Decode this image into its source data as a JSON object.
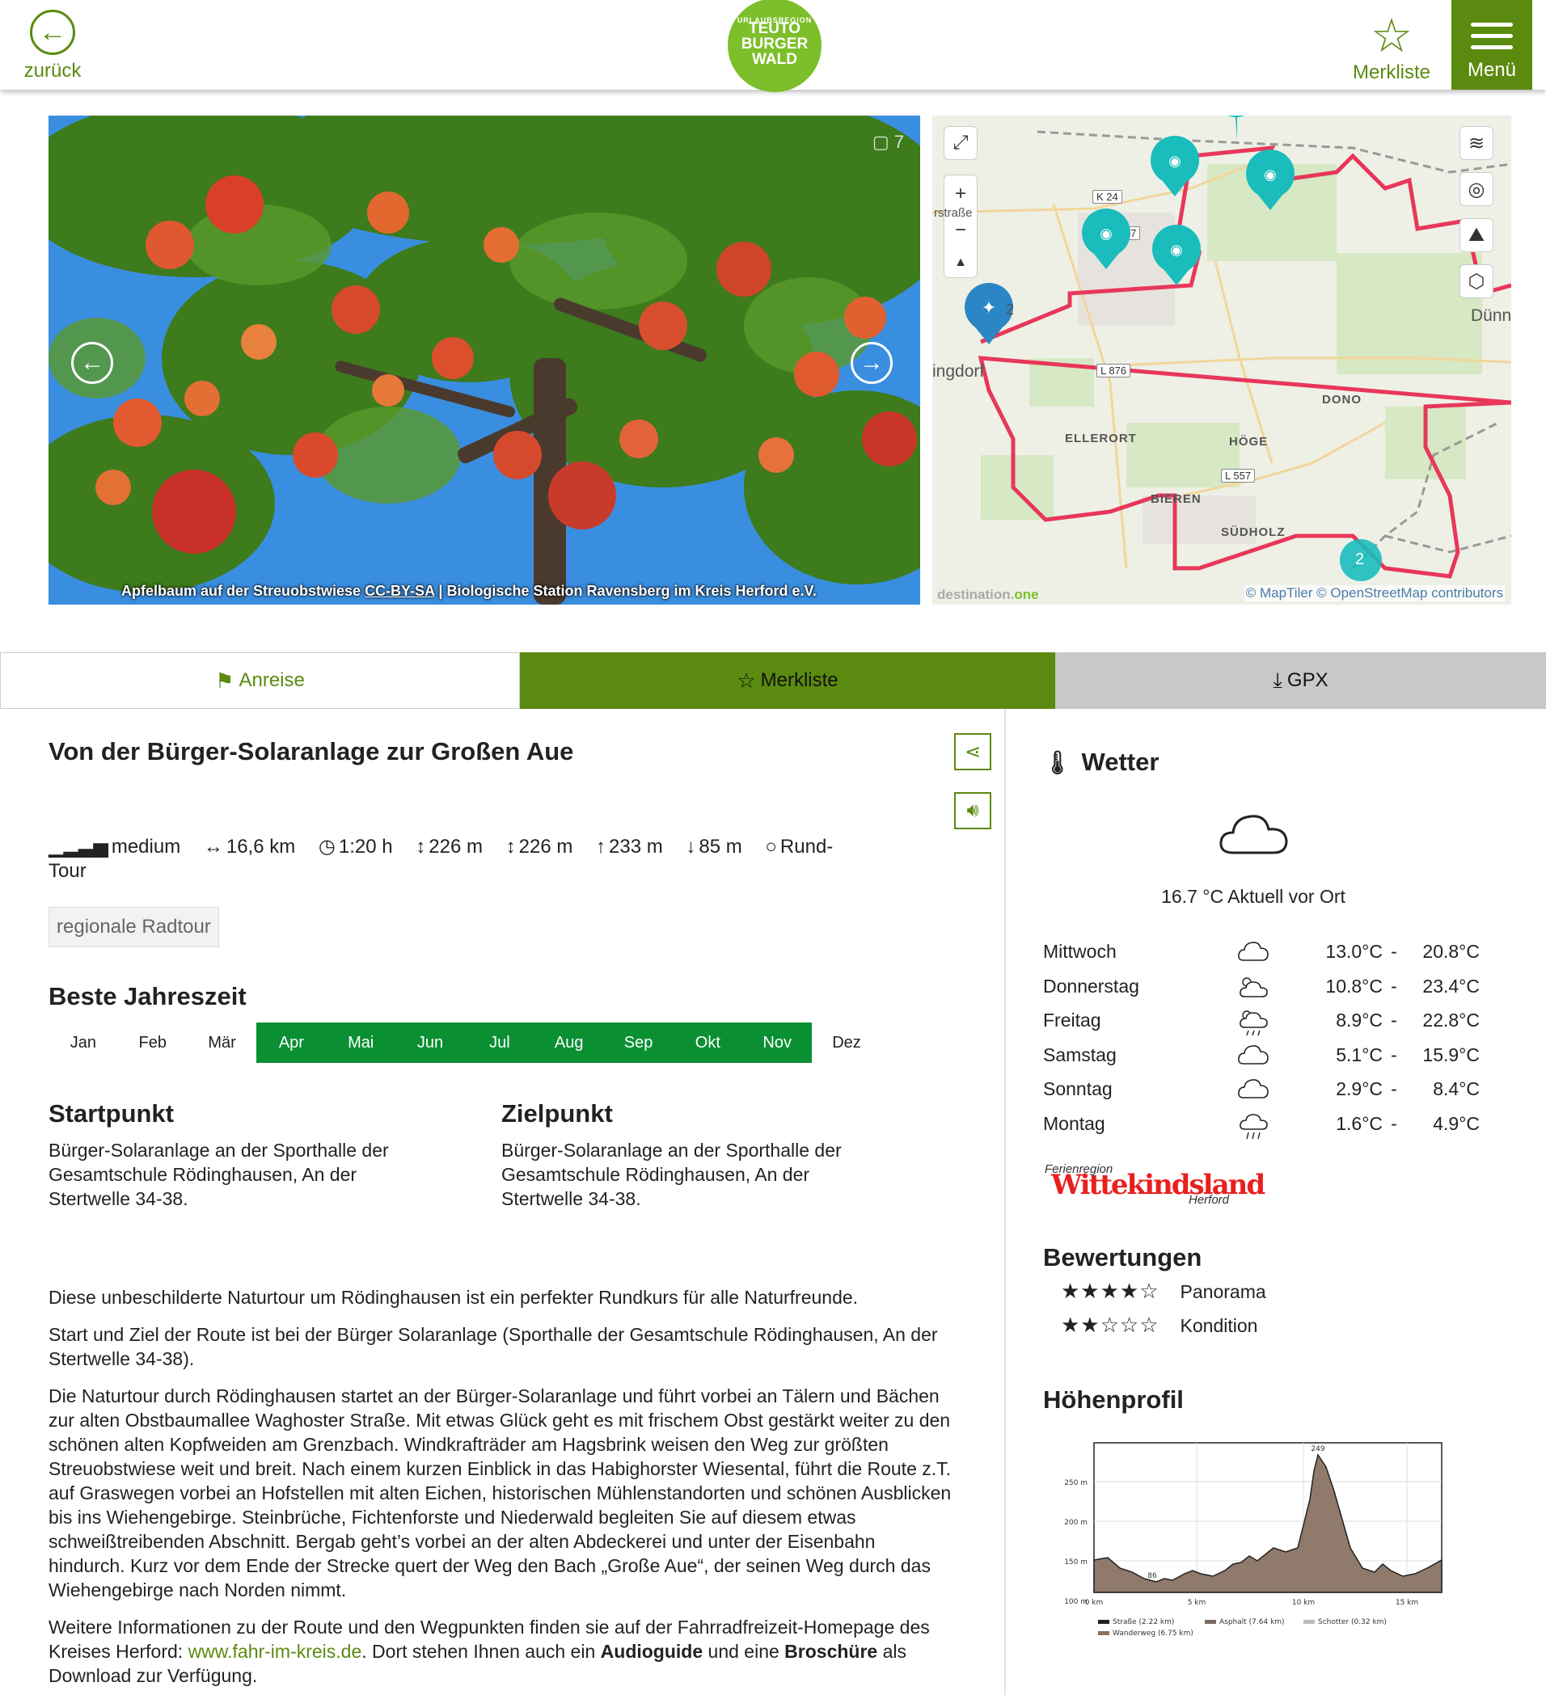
{
  "header": {
    "back_label": "zurück",
    "logo_top": "URLAUBSREGION",
    "logo_line1": "TEUTO",
    "logo_line2": "BURGER",
    "logo_line3": "WALD",
    "merkliste_label": "Merkliste",
    "menu_label": "Menü"
  },
  "gallery": {
    "count": "7",
    "caption_prefix": "Apfelbaum auf der Streuobstwiese ",
    "caption_license": "CC-BY-SA",
    "caption_suffix": " | Biologische Station Ravensberg im Kreis Herford e.V."
  },
  "map": {
    "labels": {
      "k24": "K 24",
      "l876": "L 876",
      "l557": "L 557",
      "strasse": "rstraße",
      "ingdorf": "ingdorf",
      "duenn": "Dünn",
      "dono": "DONO",
      "ellerort": "ELLERORT",
      "hoege": "HÖGE",
      "bieren": "BIEREN",
      "suedholz": "SÜDHOLZ",
      "k7": "7",
      "marker_num": "2",
      "cluster": "2"
    },
    "attribution": "© MapTiler © OpenStreetMap contributors",
    "brand_a": "destination.",
    "brand_b": "one",
    "route_color": "#e8375a",
    "marker_color": "#1abcbc"
  },
  "actions": {
    "anreise": "Anreise",
    "merkliste": "Merkliste",
    "gpx": "GPX"
  },
  "tour": {
    "title": "Von der Bürger-Solaranlage zur Großen Aue",
    "difficulty": "medium",
    "distance": "16,6 km",
    "duration": "1:20 h",
    "ascent": "226 m",
    "descent": "226 m",
    "max_alt": "233 m",
    "min_alt": "85 m",
    "type": "Rund-Tour",
    "tag": "regionale Radtour"
  },
  "season": {
    "heading": "Beste Jahreszeit",
    "months": [
      "Jan",
      "Feb",
      "Mär",
      "Apr",
      "Mai",
      "Jun",
      "Jul",
      "Aug",
      "Sep",
      "Okt",
      "Nov",
      "Dez"
    ],
    "active": [
      false,
      false,
      false,
      true,
      true,
      true,
      true,
      true,
      true,
      true,
      true,
      false
    ]
  },
  "start": {
    "heading": "Startpunkt",
    "text": "Bürger-Solaranlage an der Sporthalle der Gesamtschule Rödinghausen, An der Stertwelle 34-38."
  },
  "ziel": {
    "heading": "Zielpunkt",
    "text": "Bürger-Solaranlage an der Sporthalle der Gesamtschule Rödinghausen, An der Stertwelle 34-38."
  },
  "description": {
    "p1": "Diese unbeschilderte Naturtour um Rödinghausen ist ein perfekter Rundkurs für alle Naturfreunde.",
    "p2": "Start und Ziel der Route ist bei der Bürger Solaranlage (Sporthalle der Gesamtschule Rödinghausen, An der Stertwelle 34-38).",
    "p3": "Die Naturtour durch Rödinghausen startet an der Bürger-Solaranlage und führt vorbei an Tälern und Bächen zur alten Obstbaumallee Waghoster Straße. Mit etwas Glück geht es mit frischem Obst gestärkt weiter zu den schönen alten Kopfweiden am Grenzbach. Windkrafträder am Hagsbrink weisen den Weg zur größten Streuobstwiese weit und breit. Nach einem kurzen Einblick in das Habighorster Wiesental, führt die Route z.T. auf Graswegen vorbei an Hofstellen mit alten Eichen, historischen Mühlenstandorten und schönen Ausblicken bis ins Wiehengebirge. Steinbrüche, Fichtenforste und Niederwald begleiten Sie auf diesem etwas schweißtreibenden Abschnitt. Bergab geht’s vorbei an der alten Abdeckerei und unter der Eisenbahn hindurch. Kurz vor dem Ende der Strecke quert der Weg den Bach „Große Aue“, der seinen Weg durch das Wiehengebirge nach Norden nimmt.",
    "p4_a": "Weitere Informationen zu der Route und den Wegpunkten finden sie auf der Fahrradfreizeit-Homepage des Kreises Herford: ",
    "p4_link": "www.fahr-im-kreis.de",
    "p4_b": ". Dort stehen Ihnen auch ein ",
    "p4_audio": "Audioguide",
    "p4_c": " und eine ",
    "p4_brosch": "Broschüre",
    "p4_d": " als Download zur Verfügung."
  },
  "weather": {
    "heading": "Wetter",
    "current": "16.7 °C Aktuell vor Ort",
    "days": [
      {
        "day": "Mittwoch",
        "icon": "cloud-icon",
        "lo": "13.0°C",
        "hi": "20.8°C"
      },
      {
        "day": "Donnerstag",
        "icon": "sun-cloud-icon",
        "lo": "10.8°C",
        "hi": "23.4°C"
      },
      {
        "day": "Freitag",
        "icon": "sun-rain-icon",
        "lo": "8.9°C",
        "hi": "22.8°C"
      },
      {
        "day": "Samstag",
        "icon": "cloud-icon",
        "lo": "5.1°C",
        "hi": "15.9°C"
      },
      {
        "day": "Sonntag",
        "icon": "cloud-icon",
        "lo": "2.9°C",
        "hi": "8.4°C"
      },
      {
        "day": "Montag",
        "icon": "rain-cloud-icon",
        "lo": "1.6°C",
        "hi": "4.9°C"
      }
    ],
    "dash": "-"
  },
  "region_logo": {
    "top": "Ferienregion",
    "main": "Wittekindsland",
    "bottom": "Herford"
  },
  "ratings": {
    "heading": "Bewertungen",
    "items": [
      {
        "label": "Panorama",
        "stars": 4,
        "max": 5
      },
      {
        "label": "Kondition",
        "stars": 2,
        "max": 5
      }
    ]
  },
  "profile": {
    "heading": "Höhenprofil",
    "y_ticks": [
      "250 m",
      "200 m",
      "150 m",
      "100 m"
    ],
    "x_ticks": [
      "0 km",
      "5 km",
      "10 km",
      "15 km"
    ],
    "max_label": "249",
    "min_label": "86",
    "legend": [
      "Straße (2.22 km)",
      "Asphalt (7.64 km)",
      "Schotter (0.32 km)",
      "Wanderweg (6.75 km)"
    ]
  }
}
